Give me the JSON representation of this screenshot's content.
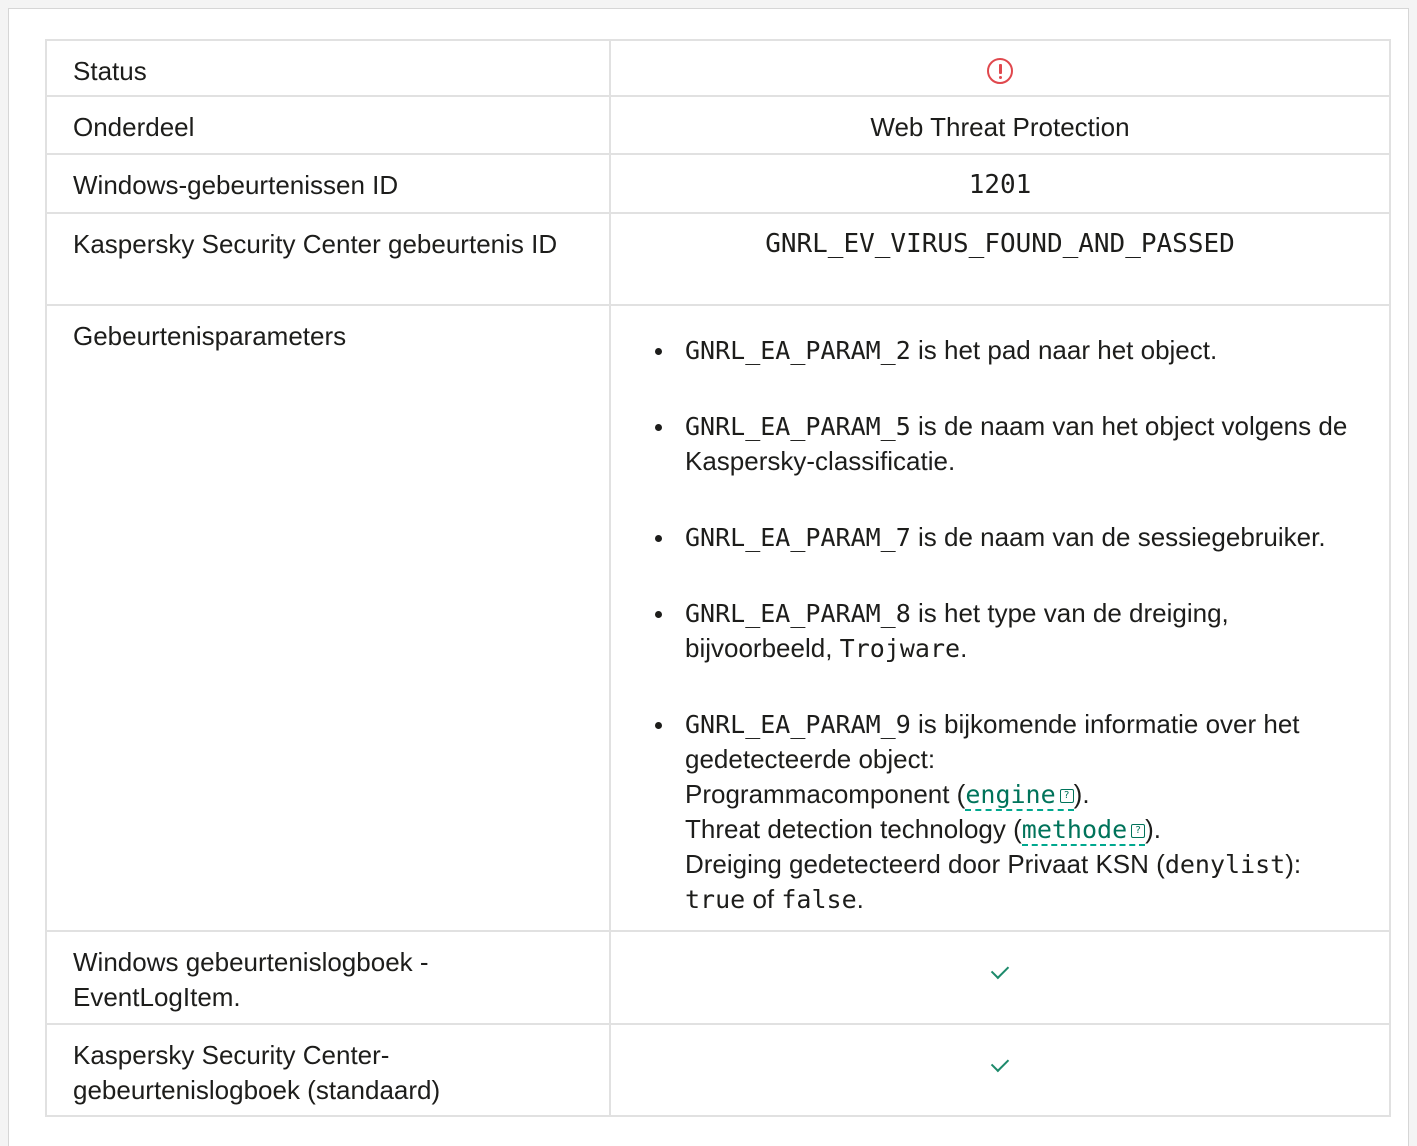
{
  "rows": {
    "status": {
      "label": "Status",
      "icon": "warning-circle-icon"
    },
    "component": {
      "label": "Onderdeel",
      "value": "Web Threat Protection"
    },
    "windows_id": {
      "label": "Windows-gebeurtenissen ID",
      "value": "1201"
    },
    "ksc_id": {
      "label": "Kaspersky Security Center gebeurtenis ID",
      "value": "GNRL_EV_VIRUS_FOUND_AND_PASSED"
    },
    "params": {
      "label": "Gebeurtenisparameters",
      "items": [
        {
          "code": "GNRL_EA_PARAM_2",
          "text": " is het pad naar het object."
        },
        {
          "code": "GNRL_EA_PARAM_5",
          "text": " is de naam van het object volgens de Kaspersky-classificatie."
        },
        {
          "code": "GNRL_EA_PARAM_7",
          "text": " is de naam van de sessiegebruiker."
        },
        {
          "code": "GNRL_EA_PARAM_8",
          "text": " is het type van de dreiging, bijvoorbeeld, ",
          "example": "Trojware",
          "tail": "."
        },
        {
          "code": "GNRL_EA_PARAM_9",
          "text": " is bijkomende informatie over het gedetecteerde object:",
          "line1_prefix": "Programmacomponent (",
          "line1_term": "engine",
          "line1_suffix": ").",
          "line2_prefix": "Threat detection technology (",
          "line2_term": "methode",
          "line2_suffix": ").",
          "line3_prefix": "Dreiging gedetecteerd door Privaat KSN (",
          "line3_code": "denylist",
          "line3_suffix": "):",
          "true": "true",
          "or": " of ",
          "false": "false",
          "end": "."
        }
      ]
    },
    "log1": {
      "label": "Windows gebeurtenislogboek - EventLogItem.",
      "icon": "checkmark-icon"
    },
    "log2": {
      "label": "Kaspersky Security Center-gebeurtenislogboek (standaard)",
      "icon": "checkmark-icon"
    }
  },
  "help_glyph": "?",
  "colors": {
    "status_warning": "#e0484d",
    "check": "#1d8a6b",
    "link": "#00735a"
  }
}
